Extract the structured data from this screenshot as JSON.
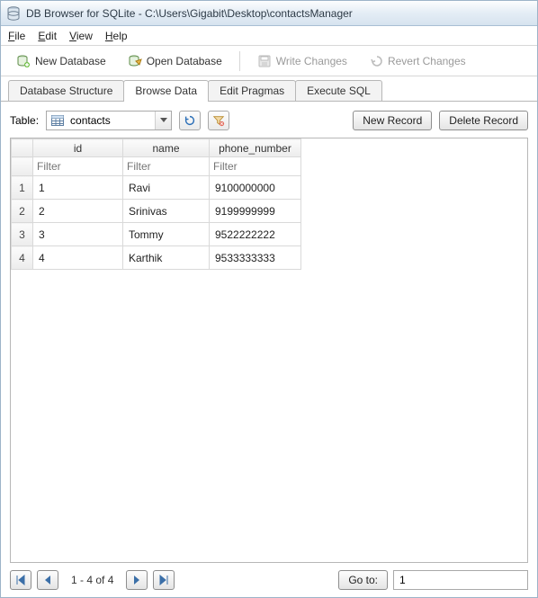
{
  "window": {
    "title": "DB Browser for SQLite - C:\\Users\\Gigabit\\Desktop\\contactsManager"
  },
  "menu": {
    "file": "File",
    "edit": "Edit",
    "view": "View",
    "help": "Help"
  },
  "toolbar": {
    "new_db": "New Database",
    "open_db": "Open Database",
    "write_changes": "Write Changes",
    "revert_changes": "Revert Changes"
  },
  "tabs": {
    "structure": "Database Structure",
    "browse": "Browse Data",
    "pragmas": "Edit Pragmas",
    "execute": "Execute SQL"
  },
  "browse": {
    "table_label": "Table:",
    "selected_table": "contacts",
    "new_record": "New Record",
    "delete_record": "Delete Record",
    "columns": {
      "id": "id",
      "name": "name",
      "phone": "phone_number"
    },
    "filter_placeholder": "Filter",
    "rows": [
      {
        "num": "1",
        "id": "1",
        "name": "Ravi",
        "phone": "9100000000"
      },
      {
        "num": "2",
        "id": "2",
        "name": "Srinivas",
        "phone": "9199999999"
      },
      {
        "num": "3",
        "id": "3",
        "name": "Tommy",
        "phone": "9522222222"
      },
      {
        "num": "4",
        "id": "4",
        "name": "Karthik",
        "phone": "9533333333"
      }
    ],
    "pager_text": "1 - 4 of 4",
    "goto_label": "Go to:",
    "goto_value": "1"
  }
}
